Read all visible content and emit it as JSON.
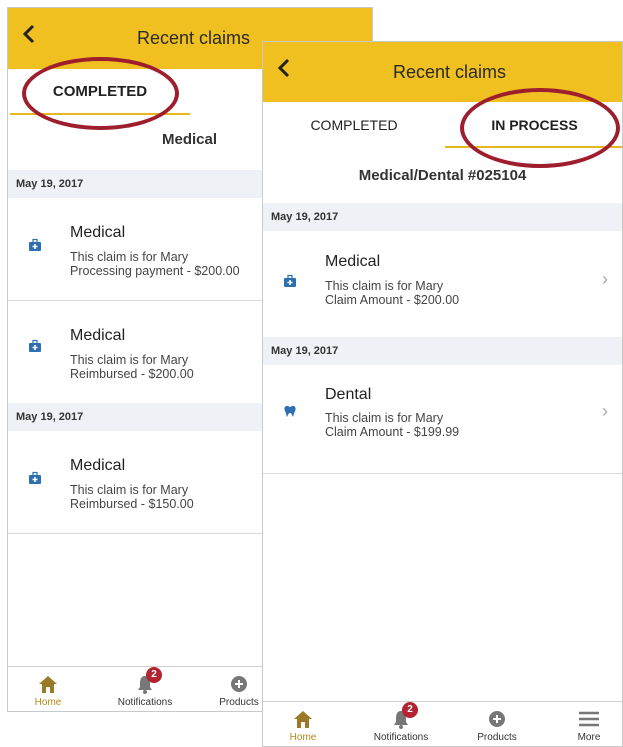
{
  "left": {
    "title": "Recent claims",
    "back_icon": "chevron-left-icon",
    "tab_completed": "COMPLETED",
    "subtitle": "Medical",
    "groups": [
      {
        "date": "May 19, 2017",
        "claims": [
          {
            "icon": "medical-kit-icon",
            "name": "Medical",
            "line1": "This claim is for Mary",
            "line2": "Processing payment - $200.00"
          },
          {
            "icon": "medical-kit-icon",
            "name": "Medical",
            "line1": "This claim is for Mary",
            "line2": "Reimbursed - $200.00"
          }
        ]
      },
      {
        "date": "May 19, 2017",
        "claims": [
          {
            "icon": "medical-kit-icon",
            "name": "Medical",
            "line1": "This claim is for Mary",
            "line2": "Reimbursed - $150.00"
          }
        ]
      }
    ],
    "nav": {
      "home": "Home",
      "notifications": "Notifications",
      "products": "Products",
      "badge": "2"
    }
  },
  "right": {
    "title": "Recent claims",
    "back_icon": "chevron-left-icon",
    "tab_completed": "COMPLETED",
    "tab_in_process": "IN PROCESS",
    "subtitle": "Medical/Dental #025104",
    "groups": [
      {
        "date": "May 19, 2017",
        "claims": [
          {
            "icon": "medical-kit-icon",
            "name": "Medical",
            "line1": "This claim is for Mary",
            "line2": "Claim Amount - $200.00"
          }
        ]
      },
      {
        "date": "May 19, 2017",
        "claims": [
          {
            "icon": "tooth-icon",
            "name": "Dental",
            "line1": "This claim is for Mary",
            "line2": "Claim Amount - $199.99"
          }
        ]
      }
    ],
    "nav": {
      "home": "Home",
      "notifications": "Notifications",
      "products": "Products",
      "more": "More",
      "badge": "2"
    }
  },
  "colors": {
    "header": "#f0c020",
    "accent": "#e6b81e",
    "highlight_ring": "#9e1e2d",
    "icon_blue": "#2e6fb0",
    "badge": "#b22432"
  }
}
